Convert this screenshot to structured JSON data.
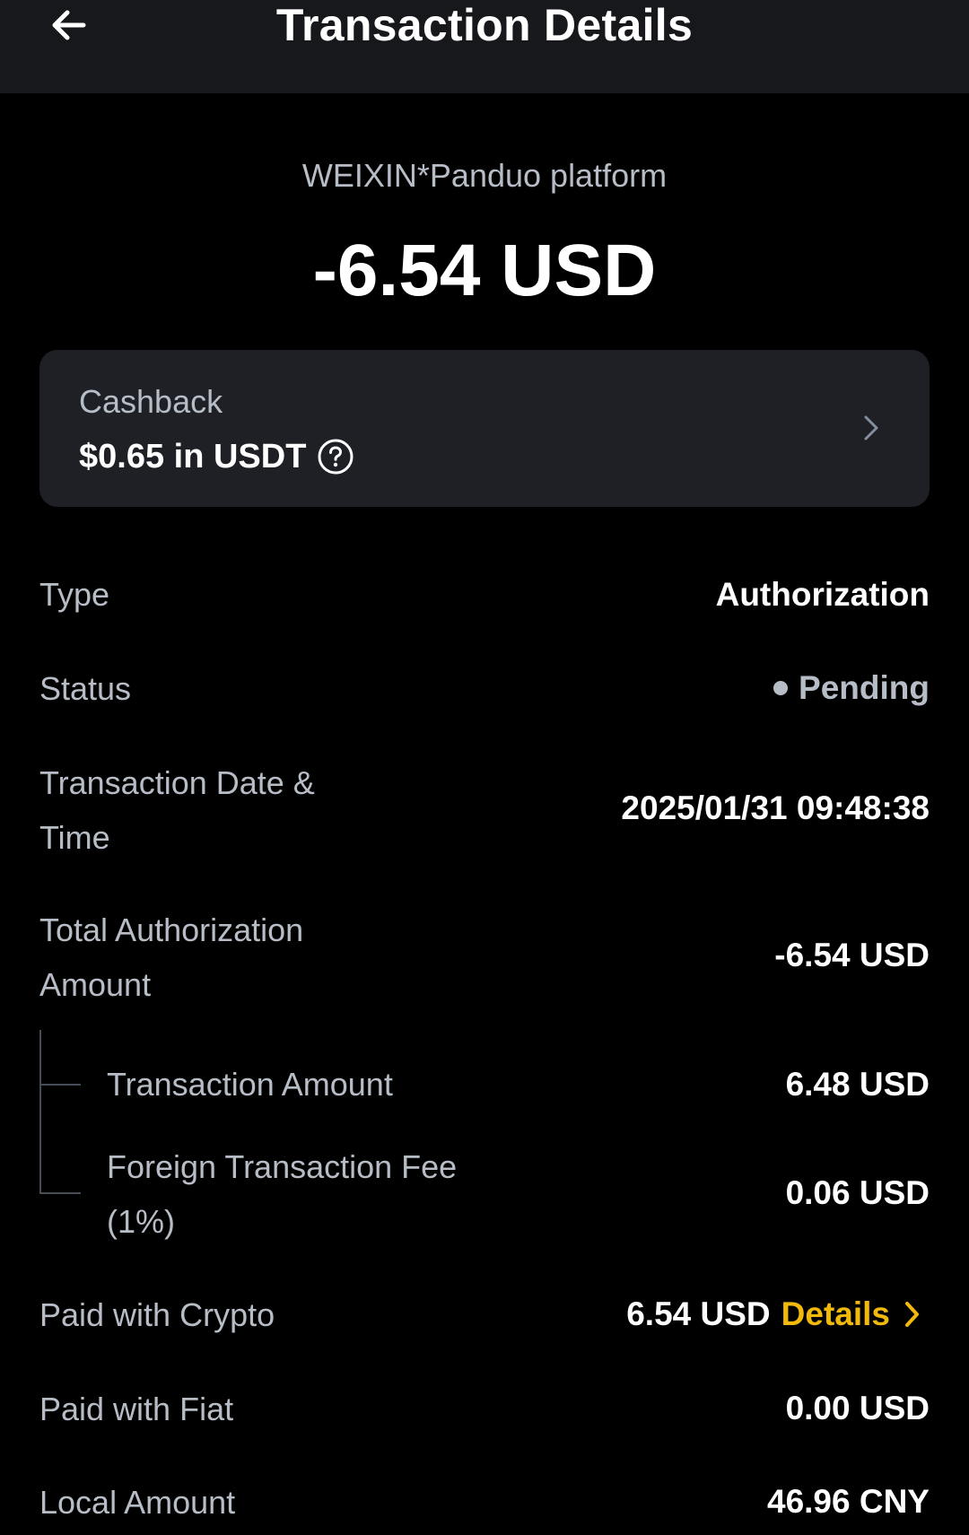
{
  "header": {
    "title": "Transaction Details"
  },
  "summary": {
    "merchant": "WEIXIN*Panduo platform",
    "amount": "-6.54 USD"
  },
  "cashback": {
    "label": "Cashback",
    "value": "$0.65 in USDT"
  },
  "details": {
    "type_label": "Type",
    "type_value": "Authorization",
    "status_label": "Status",
    "status_value": "Pending",
    "date_label": "Transaction Date &",
    "date_label_2": "Time",
    "date_value": "2025/01/31 09:48:38",
    "total_label": "Total Authorization",
    "total_label_2": "Amount",
    "total_value": "-6.54 USD",
    "tx_amount_label": "Transaction Amount",
    "tx_amount_value": "6.48 USD",
    "fee_label": "Foreign Transaction Fee",
    "fee_label_2": "(1%)",
    "fee_value": "0.06 USD",
    "crypto_label": "Paid with Crypto",
    "crypto_value": "6.54 USD",
    "crypto_details_link": "Details",
    "fiat_label": "Paid with Fiat",
    "fiat_value": "0.00 USD",
    "local_label": "Local Amount",
    "local_value": "46.96 CNY"
  },
  "icons": {
    "back": "arrow-left-icon",
    "help": "question-circle-icon",
    "chevron": "chevron-right-icon"
  },
  "colors": {
    "background": "#000000",
    "header_bg": "#16181c",
    "card_bg": "#1e2026",
    "muted_text": "#b7bdc6",
    "accent": "#f0b90b"
  }
}
